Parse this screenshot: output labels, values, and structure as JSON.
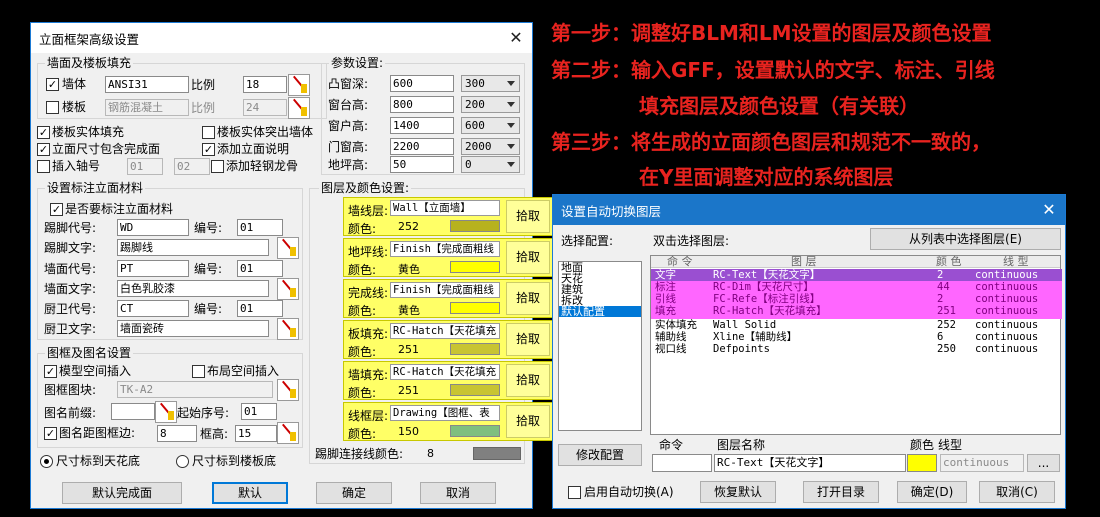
{
  "instructions": {
    "step1": "第一步：调整好BLM和LM设置的图层及颜色设置",
    "step2a": "第二步：输入GFF，设置默认的文字、标注、引线",
    "step2b": "填充图层及颜色设置（有关联）",
    "step3a": "第三步：将生成的立面颜色图层和规范不一致的，",
    "step3b": "在Y里面调整对应的系统图层"
  },
  "left_dialog": {
    "title": "立面框架高级设置",
    "wall_group": {
      "label": "墙面及楼板填充",
      "wall_label": "墙体",
      "wall_checked": true,
      "wall_pattern": "ANSI31",
      "ratio_label": "比例",
      "wall_ratio": "18",
      "slab_label": "楼板",
      "slab_checked": false,
      "slab_pattern": "钢筋混凝土",
      "slab_ratio_label": "比例",
      "slab_ratio": "24"
    },
    "options": {
      "solid_fill": "楼板实体填充",
      "solid_fill_checked": true,
      "slab_out_wall": "楼板实体突出墙体",
      "slab_out_wall_checked": false,
      "facade_dim": "立面尺寸包含完成面",
      "facade_dim_checked": true,
      "add_desc": "添加立面说明",
      "add_desc_checked": true,
      "insert_axis": "插入轴号",
      "insert_axis_checked": false,
      "axis1": "01",
      "axis2": "02",
      "add_keel": "添加轻钢龙骨",
      "add_keel_checked": false
    },
    "params": {
      "label": "参数设置:",
      "rows": [
        {
          "label": "凸窗深:",
          "value": "600",
          "select": "300"
        },
        {
          "label": "窗台高:",
          "value": "800",
          "select": "200"
        },
        {
          "label": "窗户高:",
          "value": "1400",
          "select": "600"
        },
        {
          "label": "门窗高:",
          "value": "2200",
          "select": "2000"
        },
        {
          "label": "地坪高:",
          "value": "50",
          "select": "0"
        }
      ]
    },
    "material_group": {
      "label": "设置标注立面材料",
      "need_label": "是否要标注立面材料",
      "need_checked": true,
      "code_label": "编号:",
      "rows": [
        {
          "label": "踢脚代号:",
          "code": "WD",
          "num": "01"
        },
        {
          "label": "踢脚文字:",
          "text": "踢脚线"
        },
        {
          "label": "墙面代号:",
          "code": "PT",
          "num": "01"
        },
        {
          "label": "墙面文字:",
          "text": "白色乳胶漆"
        },
        {
          "label": "厨卫代号:",
          "code": "CT",
          "num": "01"
        },
        {
          "label": "厨卫文字:",
          "text": "墙面瓷砖"
        }
      ]
    },
    "frame_group": {
      "label": "图框及图名设置",
      "model_space": "模型空间插入",
      "model_space_checked": true,
      "layout_space": "布局空间插入",
      "layout_space_checked": false,
      "frame_block_label": "图框图块:",
      "frame_block": "TK-A2",
      "name_prefix_label": "图名前缀:",
      "name_prefix": "",
      "start_no_label": "起始序号:",
      "start_no": "01",
      "name_dist_label": "图名距图框边:",
      "name_dist_checked": true,
      "name_dist": "8",
      "frame_height_label": "框高:",
      "frame_height": "15"
    },
    "layers": {
      "label": "图层及颜色设置:",
      "color_label": "颜色:",
      "pick_label": "拾取",
      "rows": [
        {
          "name": "墙线层:",
          "layer": "Wall【立面墙】",
          "color": "252",
          "swatch": "#b7b21e"
        },
        {
          "name": "地坪线:",
          "layer": "Finish【完成面粗线",
          "color": "黄色",
          "swatch": "#ffff00"
        },
        {
          "name": "完成线:",
          "layer": "Finish【完成面粗线",
          "color": "黄色",
          "swatch": "#ffff00"
        },
        {
          "name": "板填充:",
          "layer": "RC-Hatch【天花填充",
          "color": "251",
          "swatch": "#c8c432"
        },
        {
          "name": "墙填充:",
          "layer": "RC-Hatch【天花填充",
          "color": "251",
          "swatch": "#c8c432"
        },
        {
          "name": "线框层:",
          "layer": "Drawing【图框、表",
          "color": "150",
          "swatch": "#7fbf7f"
        }
      ],
      "kick_color_label": "踢脚连接线颜色:",
      "kick_color": "8",
      "kick_swatch": "#808080"
    },
    "radio_ceiling": "尺寸标到天花底",
    "radio_ceiling_on": true,
    "radio_slab": "尺寸标到楼板底",
    "radio_slab_on": false,
    "buttons": {
      "default_finish": "默认完成面",
      "default": "默认",
      "ok": "确定",
      "cancel": "取消"
    }
  },
  "right_dialog": {
    "title": "设置自动切换图层",
    "select_config_label": "选择配置:",
    "configs": [
      "地面",
      "天花",
      "建筑",
      "拆改",
      "默认配置"
    ],
    "selected_config": "默认配置",
    "dblclick_label": "双击选择图层:",
    "from_list_button": "从列表中选择图层(E)",
    "headers": {
      "cmd": "命 令",
      "layer": "图 层",
      "color": "颜 色",
      "ltype": "线 型"
    },
    "rows": [
      {
        "cmd": "文字",
        "layer": "RC-Text【天花文字】",
        "color": "2",
        "ltype": "continuous",
        "hl": "sel"
      },
      {
        "cmd": "标注",
        "layer": "RC-Dim【天花尺寸】",
        "color": "44",
        "ltype": "continuous",
        "hl": "pink"
      },
      {
        "cmd": "引线",
        "layer": "FC-Refe【标注引线】",
        "color": "2",
        "ltype": "continuous",
        "hl": "pink"
      },
      {
        "cmd": "填充",
        "layer": "RC-Hatch【天花填充】",
        "color": "251",
        "ltype": "continuous",
        "hl": "pink"
      },
      {
        "cmd": "实体填充",
        "layer": "Wall Solid",
        "color": "252",
        "ltype": "continuous",
        "hl": ""
      },
      {
        "cmd": "辅助线",
        "layer": "Xline【辅助线】",
        "color": "6",
        "ltype": "continuous",
        "hl": ""
      },
      {
        "cmd": "视口线",
        "layer": "Defpoints",
        "color": "250",
        "ltype": "continuous",
        "hl": ""
      }
    ],
    "modify_config": "修改配置",
    "edit_headers": {
      "cmd": "命令",
      "layer": "图层名称",
      "color": "颜色",
      "ltype": "线型"
    },
    "edit_cmd": "",
    "edit_layer": "RC-Text【天花文字】",
    "edit_color": "#ffff00",
    "edit_ltype": "continuous",
    "ellipsis": "...",
    "auto_switch": "启用自动切换(A)",
    "auto_switch_checked": false,
    "buttons": {
      "restore": "恢复默认",
      "open_dir": "打开目录",
      "ok": "确定(D)",
      "cancel": "取消(C)"
    }
  }
}
